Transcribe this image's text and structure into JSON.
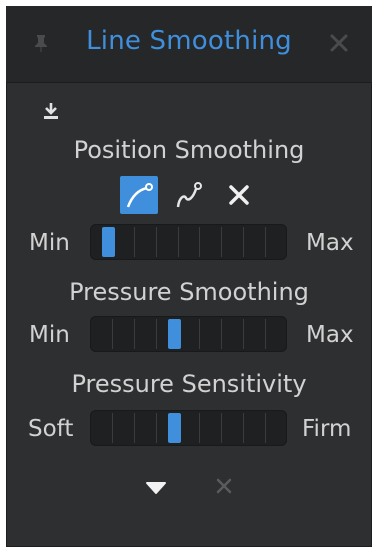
{
  "panel": {
    "title": "Line Smoothing",
    "title_color": "#3f8fdc"
  },
  "icons": {
    "pin": "pin-icon",
    "close": "close-icon",
    "download": "download-icon",
    "dropdown": "dropdown-triangle-icon",
    "reset": "reset-x-icon"
  },
  "position_smoothing": {
    "label": "Position Smoothing",
    "modes": [
      "curve-smoothing-icon",
      "node-smoothing-icon",
      "no-smoothing-icon"
    ],
    "active_mode": "curve-smoothing-icon",
    "min_label": "Min",
    "max_label": "Max",
    "value": 0.05
  },
  "pressure_smoothing": {
    "label": "Pressure Smoothing",
    "min_label": "Min",
    "max_label": "Max",
    "value": 0.42
  },
  "pressure_sensitivity": {
    "label": "Pressure Sensitivity",
    "min_label": "Soft",
    "max_label": "Firm",
    "value": 0.42
  }
}
